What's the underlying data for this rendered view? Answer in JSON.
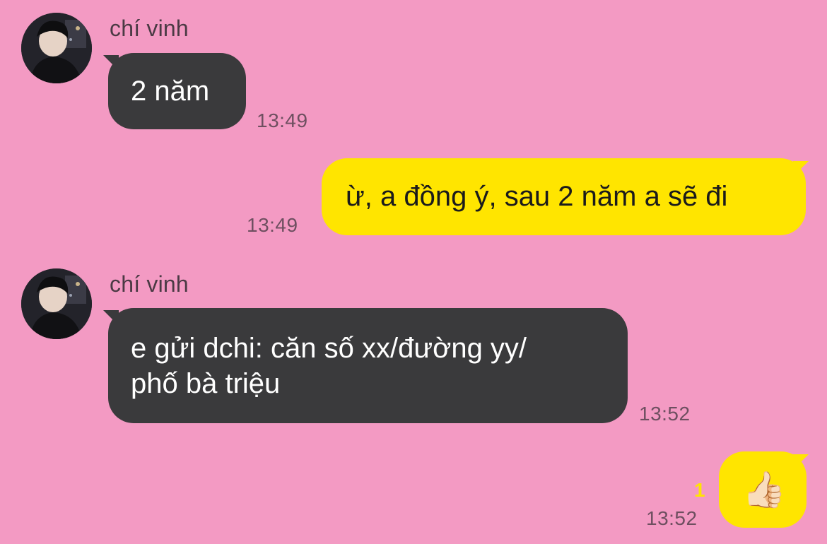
{
  "colors": {
    "background": "#f39ac3",
    "incoming_bubble": "#3a3a3c",
    "outgoing_bubble": "#ffe500",
    "timestamp": "#6e4f60",
    "unread": "#ffe500"
  },
  "messages": [
    {
      "direction": "incoming",
      "sender": "chí vinh",
      "text": "2 năm",
      "time": "13:49"
    },
    {
      "direction": "outgoing",
      "text": "ừ, a đồng ý, sau 2 năm a sẽ đi",
      "time": "13:49"
    },
    {
      "direction": "incoming",
      "sender": "chí vinh",
      "text": "e gửi dchi: căn số xx/đường yy/\nphố bà triệu",
      "time": "13:52"
    },
    {
      "direction": "outgoing",
      "emoji": "👍🏻",
      "emoji_name": "thumbs-up-icon",
      "unread_count": "1",
      "time": "13:52"
    }
  ]
}
